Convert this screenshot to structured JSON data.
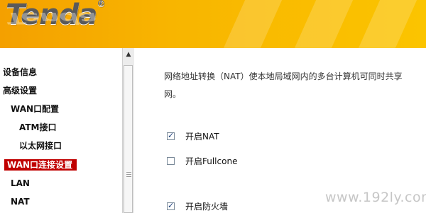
{
  "header": {
    "logo_text": "Tenda",
    "reg_mark": "®"
  },
  "sidebar": {
    "items": [
      {
        "label": "设备信息"
      },
      {
        "label": "高级设置"
      },
      {
        "label": "WAN口配置"
      },
      {
        "label": "ATM接口"
      },
      {
        "label": "以太网接口"
      },
      {
        "label": "WAN口连接设置"
      },
      {
        "label": "LAN"
      },
      {
        "label": "NAT"
      }
    ]
  },
  "scrollbar": {
    "up_arrow": "▲",
    "grip": "≡"
  },
  "content": {
    "description": "网络地址转换（NAT）使本地局域网内的多台计算机可同时共享",
    "description_cont": "网。",
    "options": [
      {
        "label": "开启NAT",
        "checked": true
      },
      {
        "label": "开启Fullcone",
        "checked": false
      },
      {
        "label": "开启防火墙",
        "checked": true
      }
    ]
  },
  "watermark": "www.192ly.com"
}
